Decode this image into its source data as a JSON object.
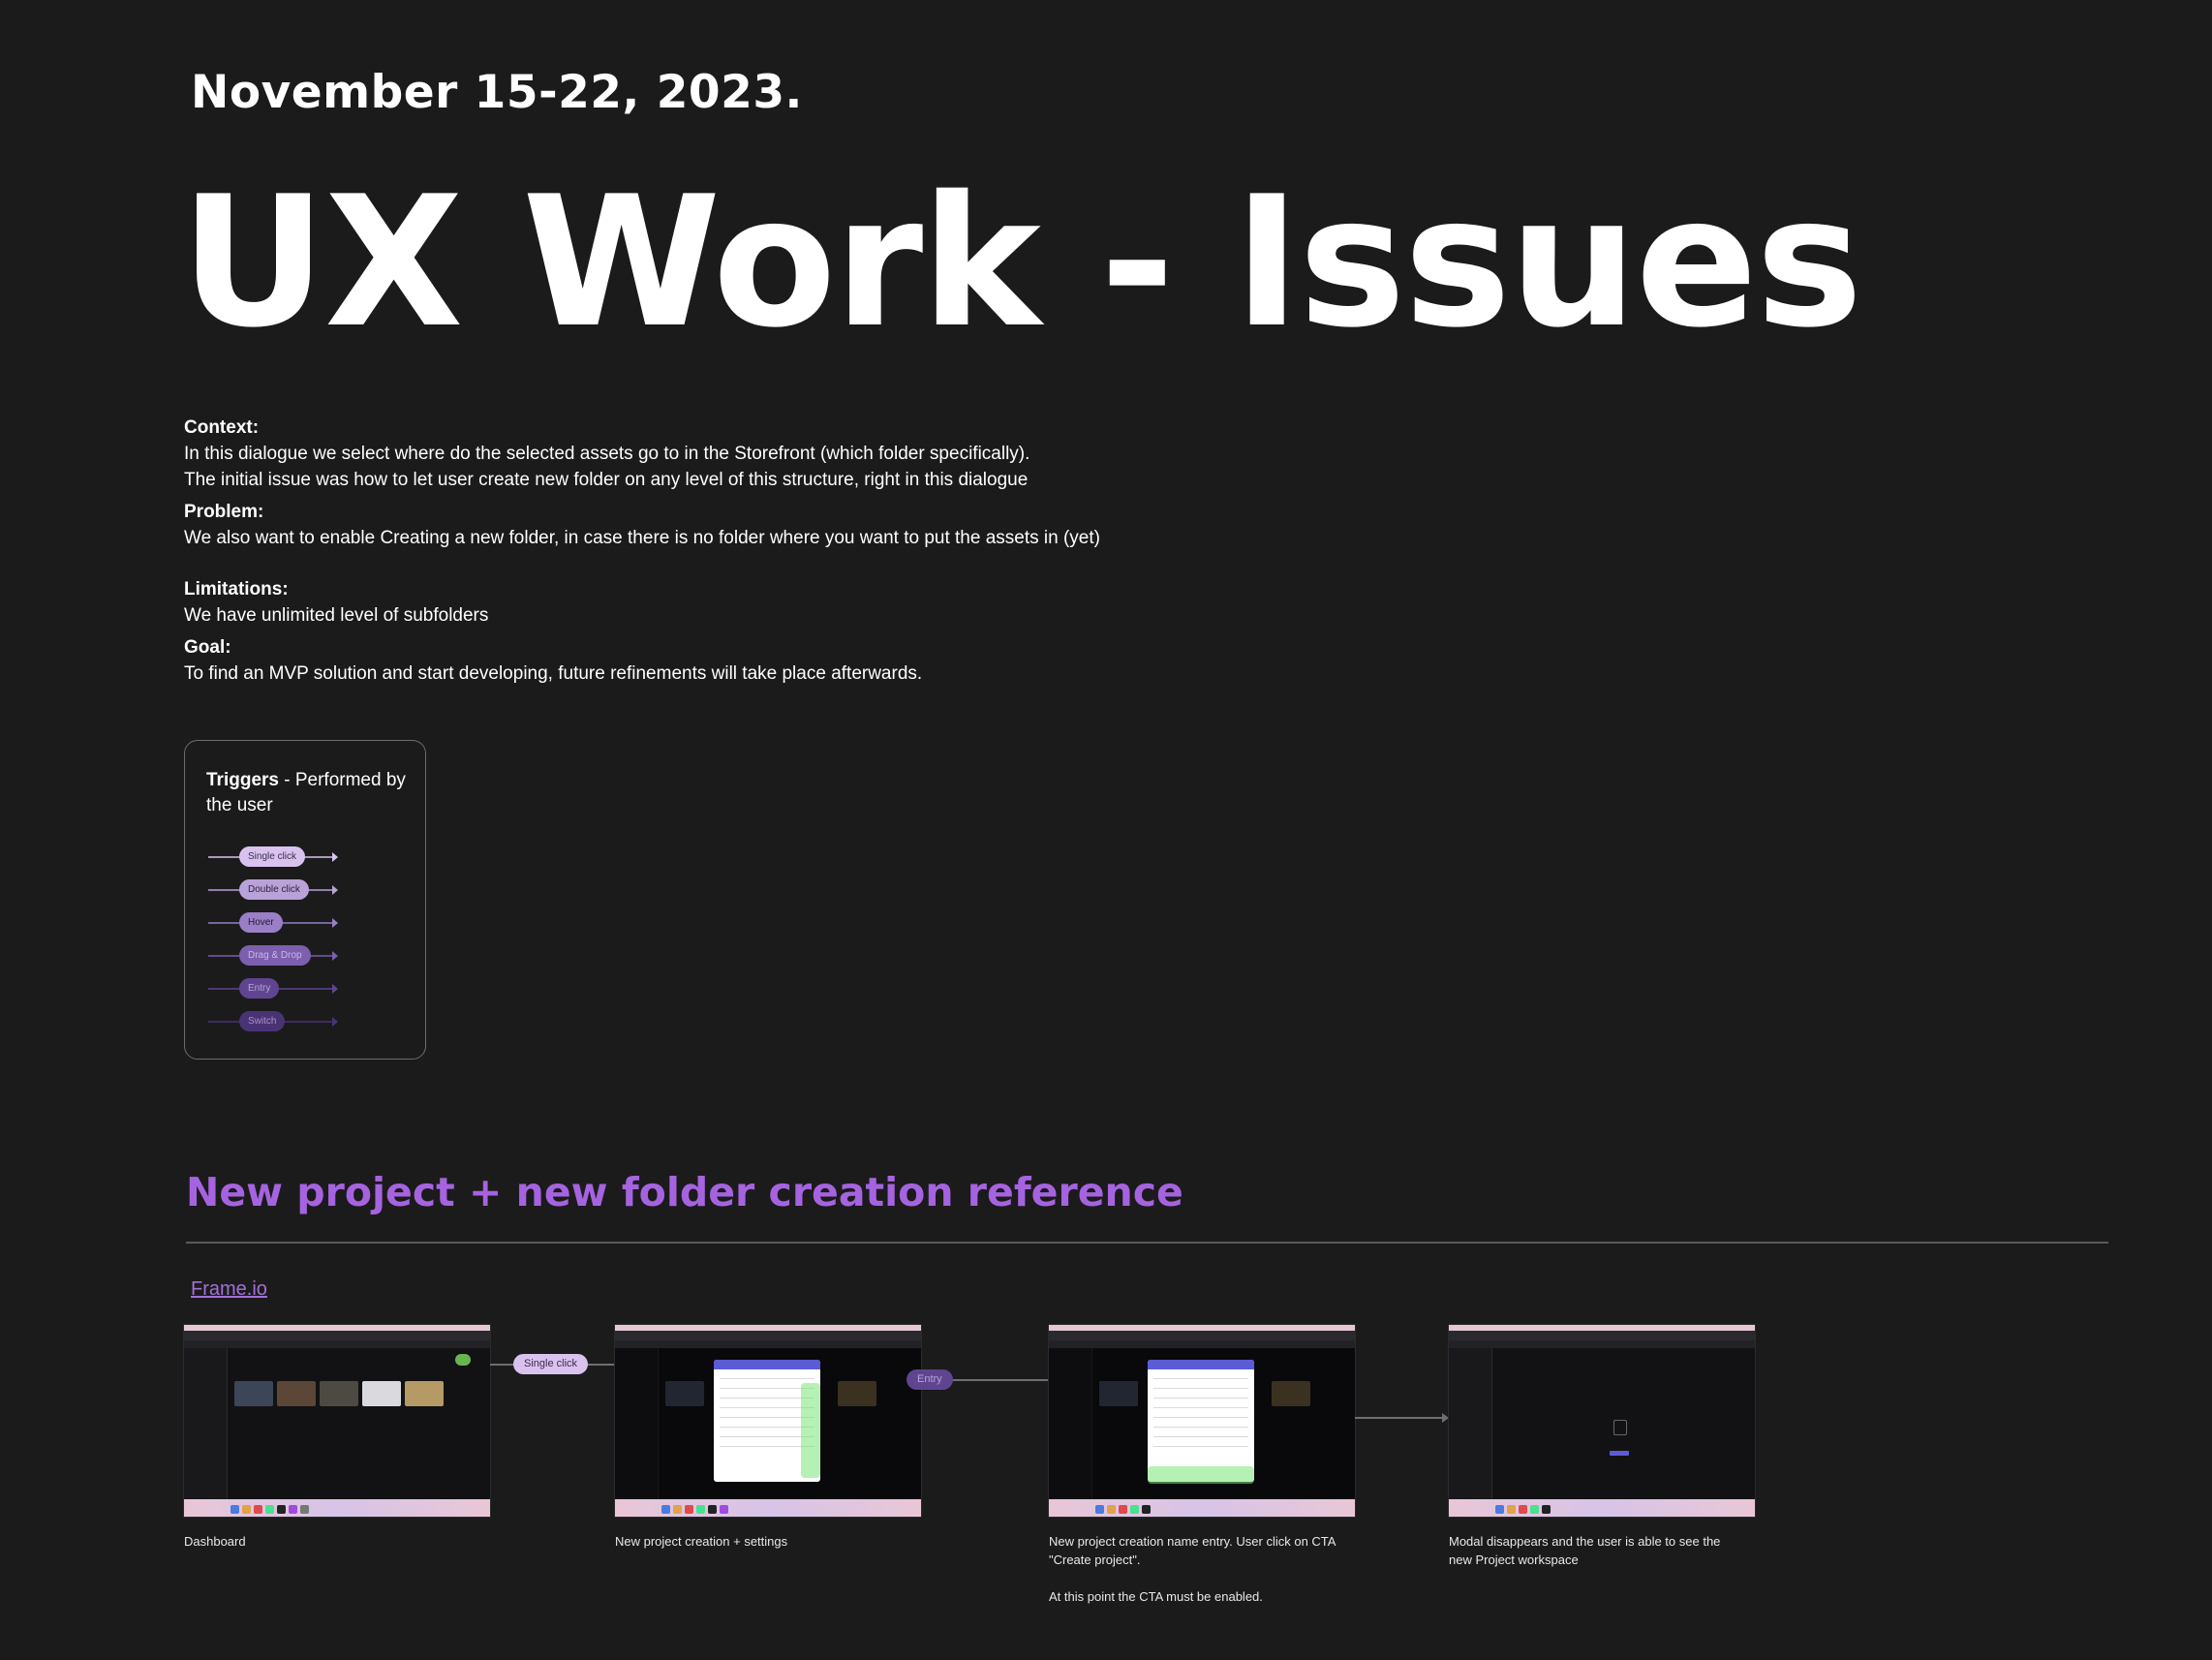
{
  "header": {
    "date": "November 15-22, 2023.",
    "title": "UX Work - Issues"
  },
  "info": {
    "context_label": "Context:",
    "context_lines": [
      "In this dialogue we select where do the selected assets go to in the Storefront (which folder specifically).",
      "The initial issue was how to let user create new folder on any level of this structure, right in this dialogue"
    ],
    "problem_label": "Problem:",
    "problem_text": "We also want to enable Creating a new folder, in case there is no folder where you want to put the assets in (yet)",
    "limitations_label": "Limitations:",
    "limitations_text": "We have unlimited level of subfolders",
    "goal_label": "Goal:",
    "goal_text": "To find an MVP solution and start developing, future refinements will take place afterwards."
  },
  "triggers": {
    "title_bold": "Triggers",
    "title_rest": " - Performed by the user",
    "items": [
      {
        "label": "Single click",
        "bg": "#d9c3ee",
        "fg": "#3a2b4d"
      },
      {
        "label": "Double click",
        "bg": "#b9a2d8",
        "fg": "#2e2342"
      },
      {
        "label": "Hover",
        "bg": "#9a7ec6",
        "fg": "#261c38"
      },
      {
        "label": "Drag & Drop",
        "bg": "#7c5fae",
        "fg": "#c9b8e4"
      },
      {
        "label": "Entry",
        "bg": "#5f4590",
        "fg": "#b7a3d8"
      },
      {
        "label": "Switch",
        "bg": "#4a3375",
        "fg": "#a892cc"
      }
    ]
  },
  "reference": {
    "section_title": "New project + new folder creation reference",
    "link_text": "Frame.io",
    "flow_triggers": {
      "single_click": "Single click",
      "entry": "Entry"
    },
    "steps": [
      {
        "caption": [
          "Dashboard"
        ]
      },
      {
        "caption": [
          "New project creation + settings"
        ]
      },
      {
        "caption": [
          "New project creation name entry. User click on CTA \"Create project\".",
          "",
          "At this point the CTA must be enabled."
        ]
      },
      {
        "caption": [
          "Modal disappears and the user is able to see the new Project workspace"
        ]
      }
    ]
  },
  "colors": {
    "background": "#1b1b1c",
    "accent_purple": "#a663e0",
    "link_purple": "#a270d6"
  }
}
